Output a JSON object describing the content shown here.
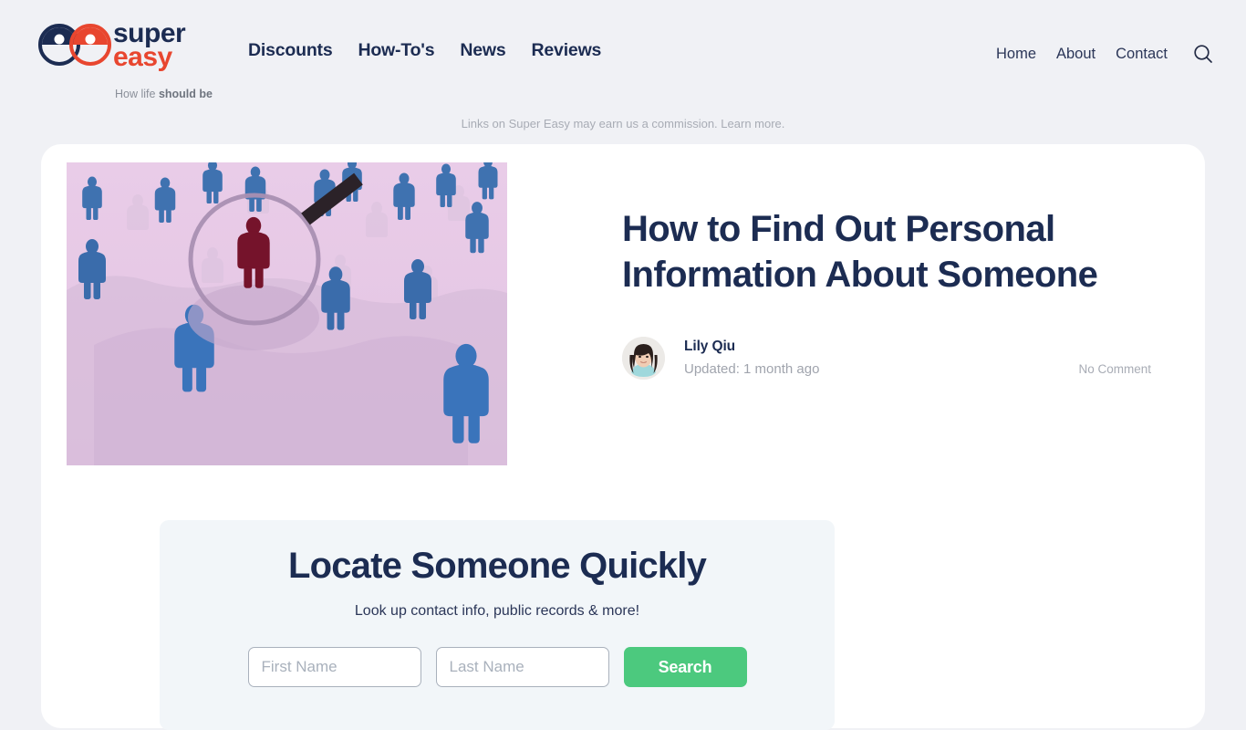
{
  "header": {
    "logo": {
      "word_top": "super",
      "word_bottom": "easy",
      "tagline_light": "How life ",
      "tagline_bold": "should be"
    },
    "main_nav": [
      {
        "label": "Discounts"
      },
      {
        "label": "How-To's"
      },
      {
        "label": "News"
      },
      {
        "label": "Reviews"
      }
    ],
    "util_nav": [
      {
        "label": "Home"
      },
      {
        "label": "About"
      },
      {
        "label": "Contact"
      }
    ],
    "search_icon": "search-icon"
  },
  "disclaimer": {
    "text": "Links on Super Easy may earn us a commission.",
    "link_label": "Learn more."
  },
  "article": {
    "title": "How to Find Out Personal Information About Someone",
    "author": "Lily Qiu",
    "updated": "Updated: 1 month ago",
    "comments": "No Comment",
    "hero_alt": "Crowd of blue figures on a map with one red figure under a magnifying glass"
  },
  "lookup": {
    "title": "Locate Someone Quickly",
    "subtitle": "Look up contact info, public records & more!",
    "first_name_value": "",
    "first_name_placeholder": "First Name",
    "last_name_value": "",
    "last_name_placeholder": "Last Name",
    "submit_label": "Search"
  },
  "colors": {
    "page_background": "#f0f1f5",
    "card_background": "#ffffff",
    "brand_navy": "#1c2c52",
    "brand_red": "#e8462f",
    "accent_green": "#4cc97e",
    "widget_background": "#f2f6f9",
    "muted_text": "#a8acb5"
  }
}
